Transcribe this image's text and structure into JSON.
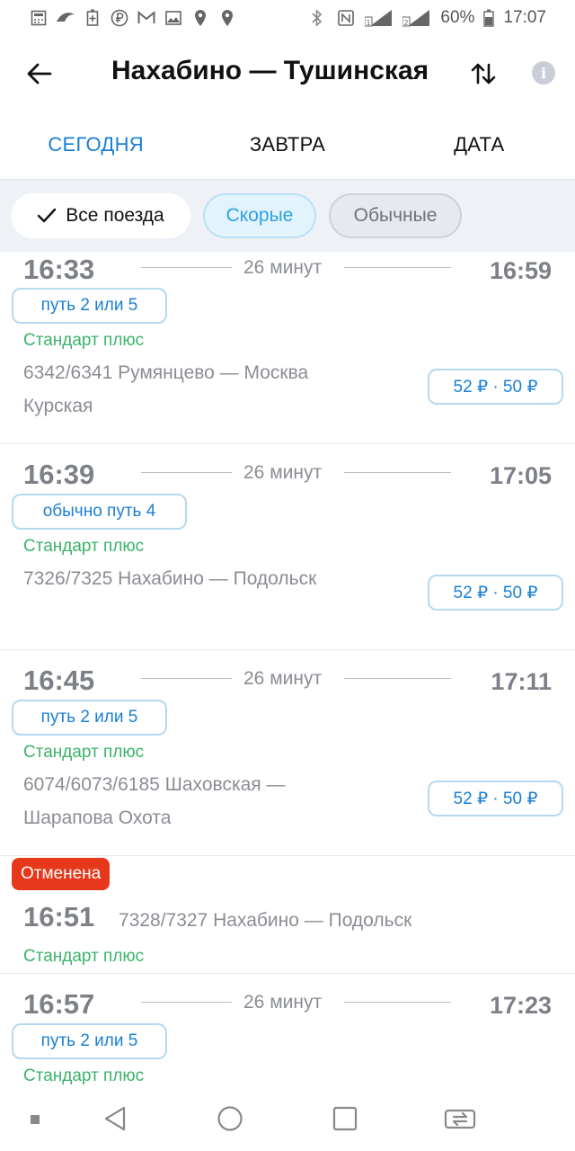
{
  "status_bar": {
    "battery_percent": "60%",
    "time": "17:07"
  },
  "header": {
    "title": "Нахабино — Тушинская"
  },
  "tabs": [
    {
      "label": "СЕГОДНЯ",
      "active": true
    },
    {
      "label": "ЗАВТРА",
      "active": false
    },
    {
      "label": "ДАТА",
      "active": false
    }
  ],
  "filters": {
    "all": "Все поезда",
    "fast": "Скорые",
    "regular": "Обычные"
  },
  "trains": [
    {
      "departure": "16:33",
      "duration": "26 минут",
      "arrival": "16:59",
      "platform": "путь 2 или 5",
      "train_class": "Стандарт плюс",
      "route_line1": "6342/6341 Румянцево — Москва",
      "route_line2": "Курская",
      "price": "52 ₽ · 50 ₽"
    },
    {
      "departure": "16:39",
      "duration": "26 минут",
      "arrival": "17:05",
      "platform": "обычно путь 4",
      "train_class": "Стандарт плюс",
      "route_line1": "7326/7325 Нахабино — Подольск",
      "route_line2": "",
      "price": "52 ₽ · 50 ₽"
    },
    {
      "departure": "16:45",
      "duration": "26 минут",
      "arrival": "17:11",
      "platform": "путь 2 или 5",
      "train_class": "Стандарт плюс",
      "route_line1": "6074/6073/6185 Шаховская —",
      "route_line2": "Шарапова Охота",
      "price": "52 ₽ · 50 ₽"
    },
    {
      "status": "Отменена",
      "departure": "16:51",
      "route_line1": "7328/7327 Нахабино — Подольск",
      "train_class": "Стандарт плюс"
    },
    {
      "departure": "16:57",
      "duration": "26 минут",
      "arrival": "17:23",
      "platform": "путь 2 или 5",
      "train_class": "Стандарт плюс"
    }
  ],
  "colors": {
    "accent": "#1a7fd4",
    "class_green": "#3bb36a",
    "cancel_red": "#e8381c",
    "fast_chip": "#2aa3e0"
  }
}
